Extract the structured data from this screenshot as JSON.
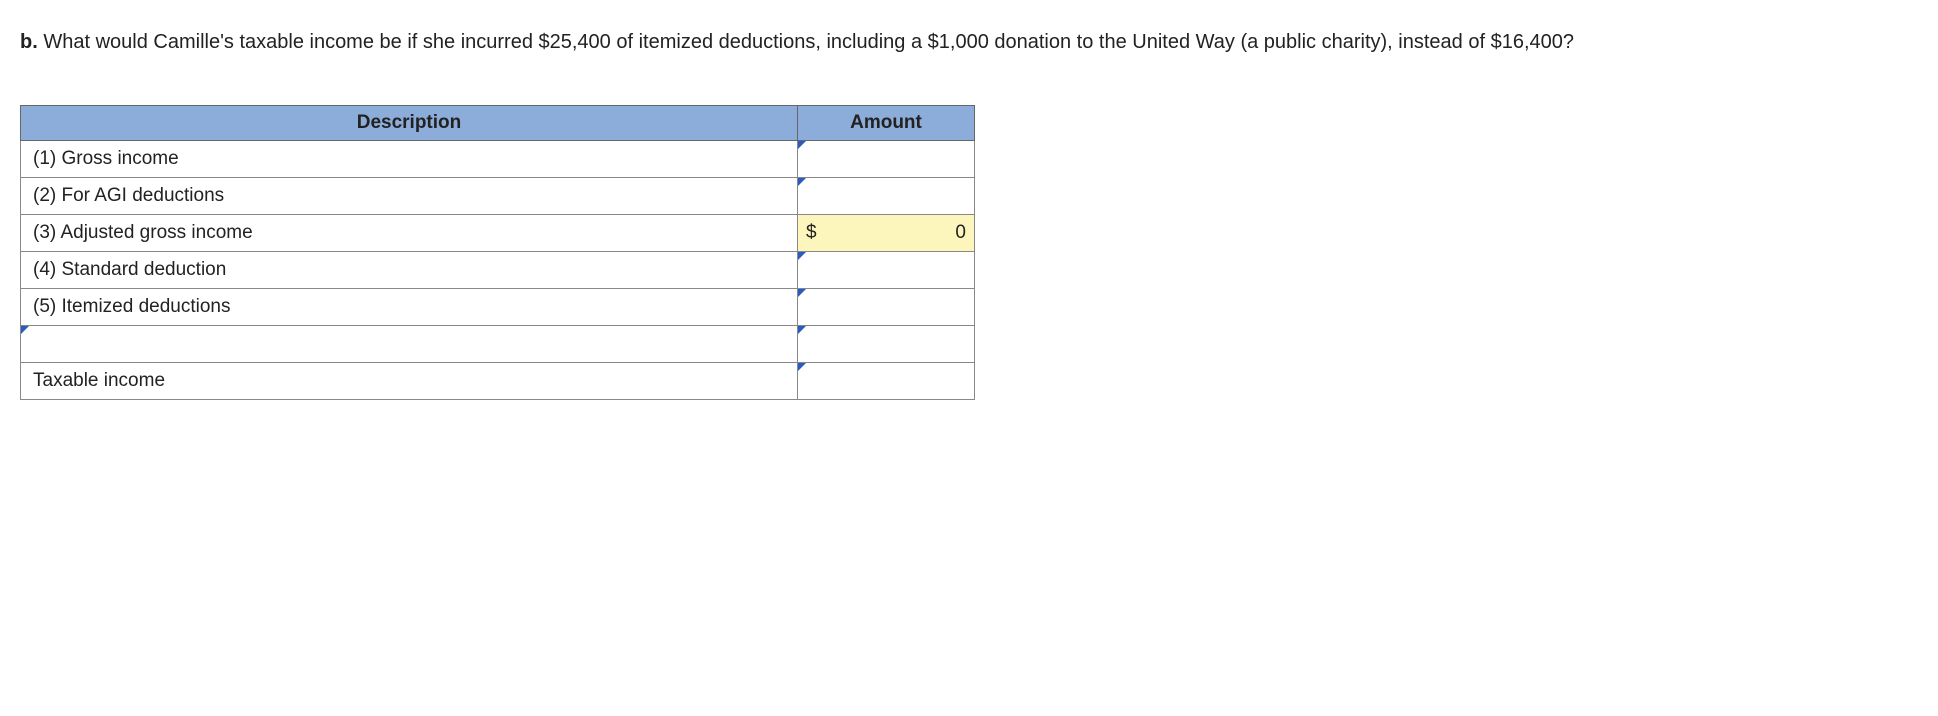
{
  "question": {
    "label": "b.",
    "text": "What would Camille's taxable income be if she incurred $25,400 of itemized deductions, including a $1,000 donation to the United Way (a public charity), instead of $16,400?"
  },
  "table": {
    "headers": {
      "description": "Description",
      "amount": "Amount"
    },
    "rows": [
      {
        "desc": "(1) Gross income",
        "dollar": "",
        "value": "",
        "calc": false,
        "desc_input": false
      },
      {
        "desc": "(2) For AGI deductions",
        "dollar": "",
        "value": "",
        "calc": false,
        "desc_input": false
      },
      {
        "desc": "(3) Adjusted gross income",
        "dollar": "$",
        "value": "0",
        "calc": true,
        "desc_input": false
      },
      {
        "desc": "(4) Standard deduction",
        "dollar": "",
        "value": "",
        "calc": false,
        "desc_input": false
      },
      {
        "desc": "(5) Itemized deductions",
        "dollar": "",
        "value": "",
        "calc": false,
        "desc_input": false
      },
      {
        "desc": "",
        "dollar": "",
        "value": "",
        "calc": false,
        "desc_input": true
      },
      {
        "desc": "Taxable income",
        "dollar": "",
        "value": "",
        "calc": false,
        "desc_input": false
      }
    ]
  }
}
